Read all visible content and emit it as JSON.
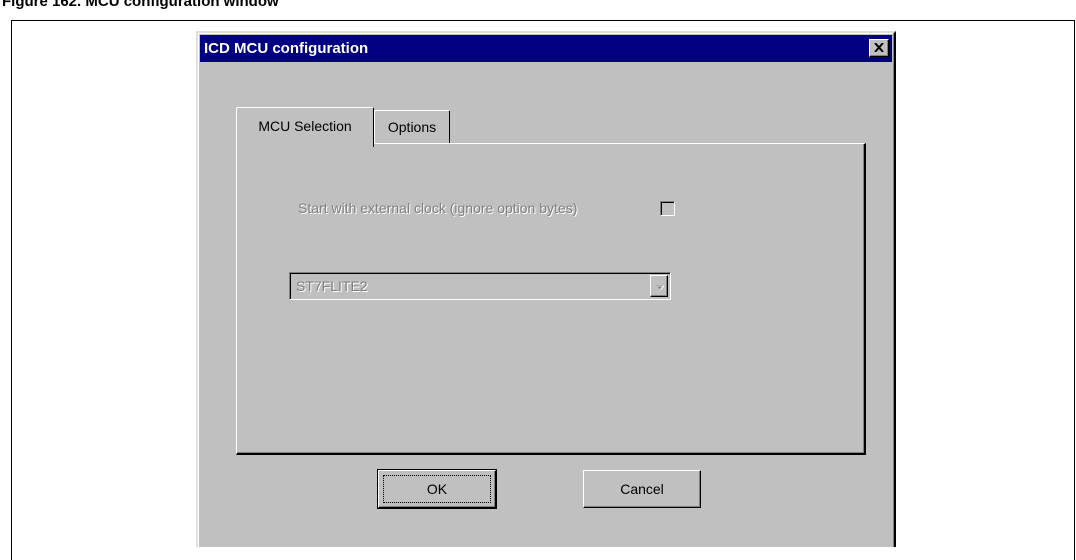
{
  "caption": "Figure 162. MCU configuration window",
  "dialog": {
    "title": "ICD MCU configuration",
    "close_glyph": "✕"
  },
  "tabs": [
    {
      "label": "MCU Selection",
      "active": true
    },
    {
      "label": "Options",
      "active": false
    }
  ],
  "mcu_selection": {
    "external_clock_label": "Start with external clock (ignore option bytes)",
    "external_clock_checked": false,
    "mcu_select_value": "ST7FLITE2",
    "enabled": false
  },
  "buttons": {
    "ok_label": "OK",
    "cancel_label": "Cancel"
  },
  "icons": {
    "close": "close-icon",
    "dropdown": "chevron-down-icon"
  },
  "colors": {
    "titlebar": "#000080",
    "face": "#c0c0c0",
    "disabled_text": "#808080"
  }
}
